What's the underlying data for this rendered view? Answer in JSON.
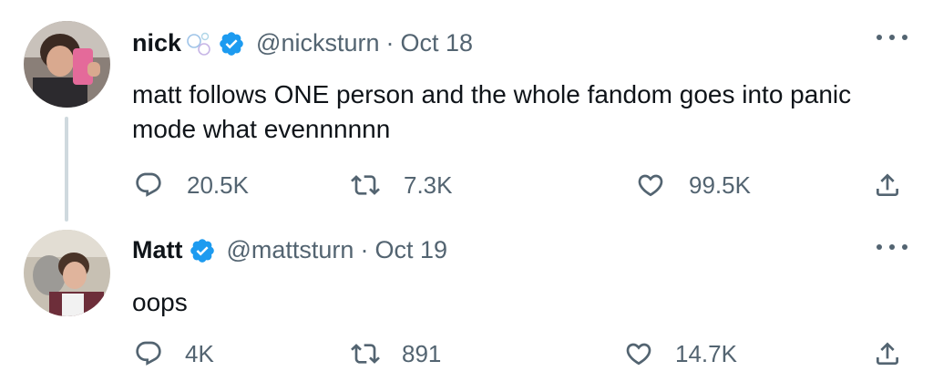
{
  "tweets": [
    {
      "name": "nick",
      "emoji_icon": "bubbles-emoji-icon",
      "verified": true,
      "handle": "@nicksturn",
      "separator": "·",
      "date": "Oct 18",
      "text": "matt follows ONE person and the whole fandom goes into panic mode what evennnnnn",
      "replies": "20.5K",
      "retweets": "7.3K",
      "likes": "99.5K"
    },
    {
      "name": "Matt",
      "verified": true,
      "handle": "@mattsturn",
      "separator": "·",
      "date": "Oct 19",
      "text": "oops",
      "replies": "4K",
      "retweets": "891",
      "likes": "14.7K"
    }
  ],
  "colors": {
    "text_primary": "#0f1419",
    "text_secondary": "#536471",
    "verified_blue": "#1d9bf0",
    "thread_line": "#cfd9de"
  }
}
